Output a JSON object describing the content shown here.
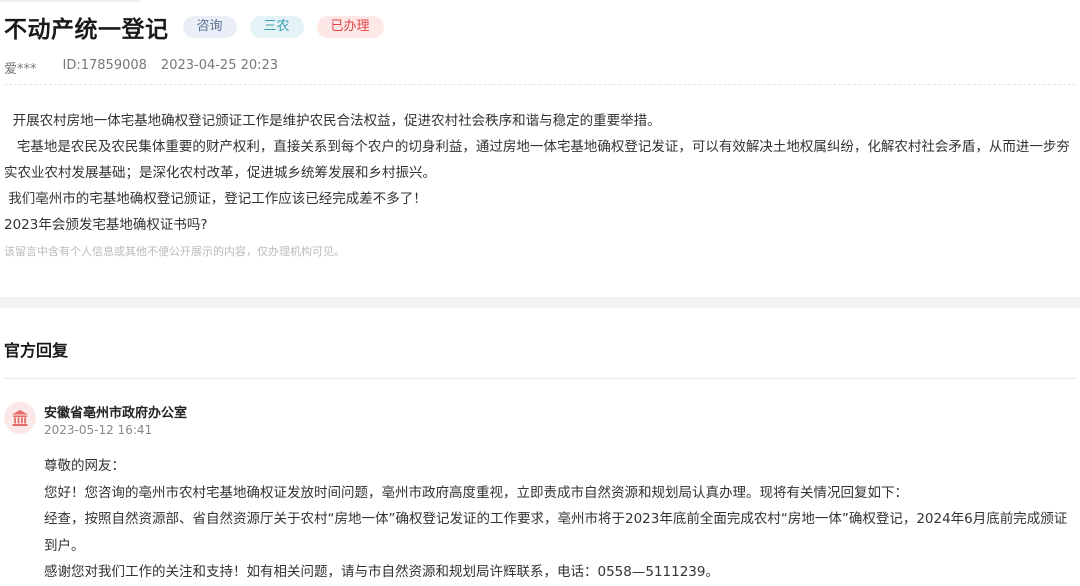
{
  "header": {
    "title": "不动产统一登记",
    "tags": [
      {
        "label": "咨询",
        "color": "#5b6f92"
      },
      {
        "label": "三农",
        "color": "#3e9fb3"
      },
      {
        "label": "已办理",
        "color": "#e04545"
      }
    ]
  },
  "meta": {
    "author": "爱***",
    "message_id": "ID:17859008",
    "date": "2023-04-25 20:23"
  },
  "message": {
    "paragraphs": [
      "  开展农村房地一体宅基地确权登记颁证工作是维护农民合法权益，促进农村社会秩序和谐与稳定的重要举措。",
      "   宅基地是农民及农民集体重要的财产权利，直接关系到每个农户的切身利益，通过房地一体宅基地确权登记发证，可以有效解决土地权属纠纷，化解农村社会矛盾，从而进一步夯实农业农村发展基础；是深化农村改革，促进城乡统筹发展和乡村振兴。",
      " 我们亳州市的宅基地确权登记颁证，登记工作应该已经完成差不多了！",
      "2023年会颁发宅基地确权证书吗?"
    ],
    "privacy_notice": "该留言中含有个人信息或其他不便公开展示的内容，仅办理机构可见。"
  },
  "official_reply": {
    "section_title": "官方回复",
    "org_icon": "government-building-icon",
    "org_name": "安徽省亳州市政府办公室",
    "date": "2023-05-12 16:41",
    "paragraphs": [
      "尊敬的网友：",
      "您好！您咨询的亳州市农村宅基地确权证发放时间问题，亳州市政府高度重视，立即责成市自然资源和规划局认真办理。现将有关情况回复如下：",
      "经查，按照自然资源部、省自然资源厅关于农村“房地一体”确权登记发证的工作要求，亳州市将于2023年底前全面完成农村“房地一体”确权登记，2024年6月底前完成颁证到户。",
      "感谢您对我们工作的关注和支持！如有相关问题，请与市自然资源和规划局许辉联系，电话：0558—5111239。"
    ]
  },
  "colors": {
    "accent_red": "#e04545",
    "tag_blue": "#5b6f92",
    "tag_cyan": "#3e9fb3"
  }
}
